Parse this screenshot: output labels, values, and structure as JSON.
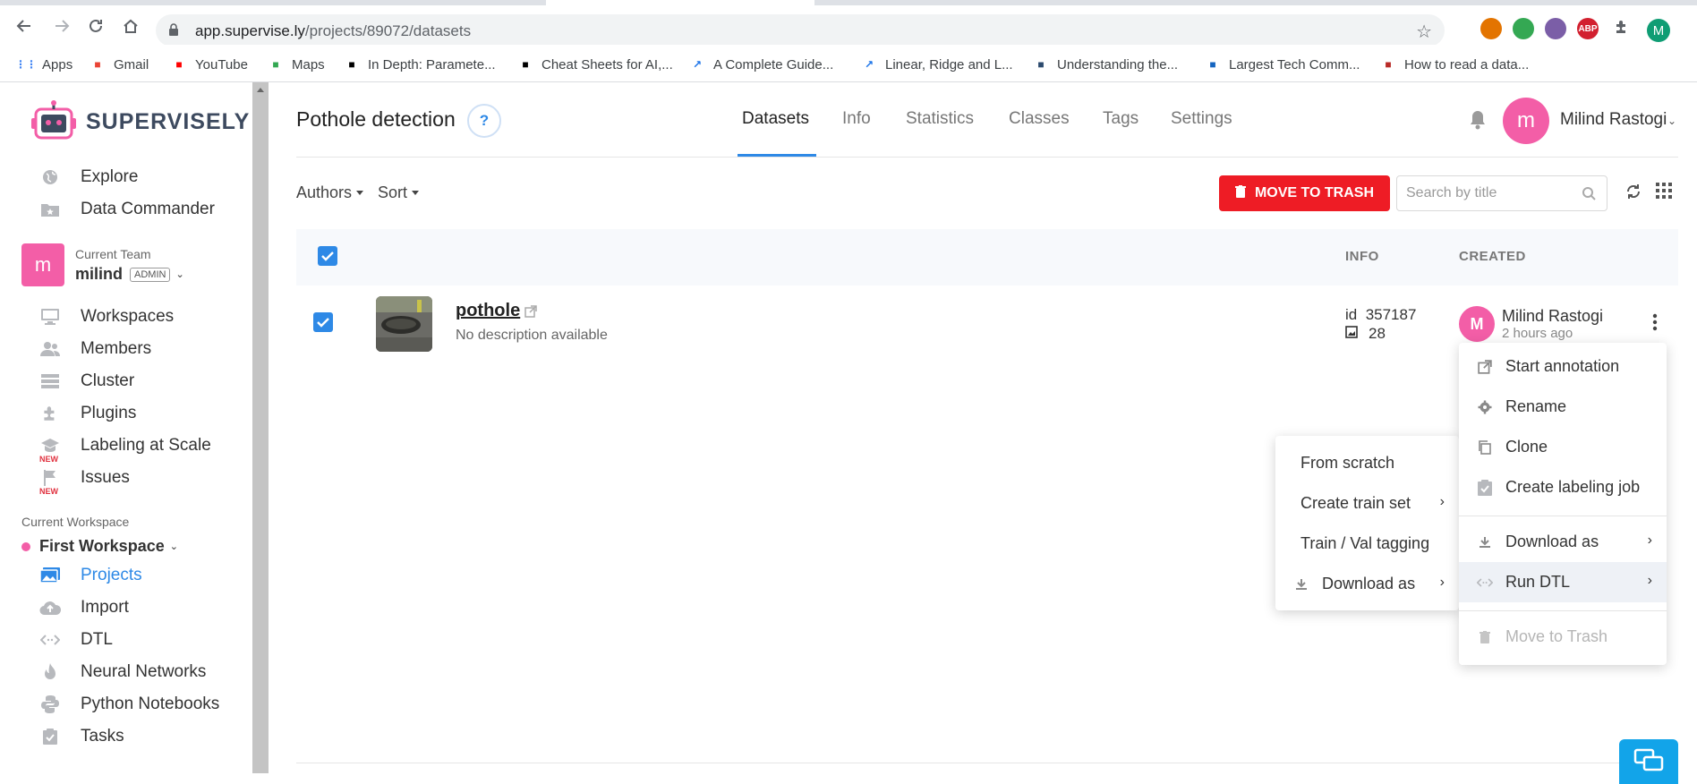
{
  "browser": {
    "url_host": "app.supervise.ly",
    "url_path": "/projects/89072/datasets",
    "profile_initial": "M",
    "extensions": [
      {
        "name": "extension-1",
        "color": "#e37400",
        "text": ""
      },
      {
        "name": "extension-2",
        "color": "#34a853",
        "text": ""
      },
      {
        "name": "extension-3",
        "color": "#7b5ea7",
        "text": ""
      },
      {
        "name": "adblock-plus",
        "color": "#d2202f",
        "text": "ABP"
      }
    ],
    "bookmarks": [
      {
        "label": "Apps",
        "icon": "apps-grid-icon",
        "color": "#4285f4"
      },
      {
        "label": "Gmail",
        "icon": "gmail-icon",
        "color": "#ea4335"
      },
      {
        "label": "YouTube",
        "icon": "youtube-icon",
        "color": "#ff0000"
      },
      {
        "label": "Maps",
        "icon": "maps-icon",
        "color": "#34a853"
      },
      {
        "label": "In Depth: Paramete...",
        "icon": "medium-icon",
        "color": "#000000"
      },
      {
        "label": "Cheat Sheets for AI,...",
        "icon": "cheatsheet-icon",
        "color": "#000000"
      },
      {
        "label": "A Complete Guide...",
        "icon": "chart-line-icon",
        "color": "#1a73e8"
      },
      {
        "label": "Linear, Ridge and L...",
        "icon": "chart-line-icon",
        "color": "#1a73e8"
      },
      {
        "label": "Understanding the...",
        "icon": "book-icon",
        "color": "#2c4a6e"
      },
      {
        "label": "Largest Tech Comm...",
        "icon": "tg-icon",
        "color": "#1565c0"
      },
      {
        "label": "How to read a data...",
        "icon": "quora-icon",
        "color": "#b92b27"
      }
    ]
  },
  "sidebar": {
    "logo_text": "SUPERVISELY",
    "top_items": [
      {
        "label": "Explore",
        "icon": "globe-icon"
      },
      {
        "label": "Data Commander",
        "icon": "folder-star-icon"
      }
    ],
    "team": {
      "caption": "Current Team",
      "initial": "m",
      "name": "milind",
      "role": "ADMIN"
    },
    "team_items": [
      {
        "label": "Workspaces",
        "icon": "monitor-icon",
        "new": false
      },
      {
        "label": "Members",
        "icon": "people-icon",
        "new": false
      },
      {
        "label": "Cluster",
        "icon": "server-icon",
        "new": false
      },
      {
        "label": "Plugins",
        "icon": "puzzle-icon",
        "new": false
      },
      {
        "label": "Labeling at Scale",
        "icon": "graduation-cap-icon",
        "new": true
      },
      {
        "label": "Issues",
        "icon": "flag-icon",
        "new": true
      }
    ],
    "new_badge": "NEW",
    "workspace": {
      "caption": "Current Workspace",
      "name": "First Workspace"
    },
    "workspace_items": [
      {
        "label": "Projects",
        "icon": "images-icon",
        "active": true
      },
      {
        "label": "Import",
        "icon": "cloud-upload-icon",
        "active": false
      },
      {
        "label": "DTL",
        "icon": "code-arrows-icon",
        "active": false
      },
      {
        "label": "Neural Networks",
        "icon": "flame-icon",
        "active": false
      },
      {
        "label": "Python Notebooks",
        "icon": "python-icon",
        "active": false
      },
      {
        "label": "Tasks",
        "icon": "clipboard-check-icon",
        "active": false
      }
    ]
  },
  "header": {
    "project_title": "Pothole detection",
    "help": "?",
    "tabs": [
      "Datasets",
      "Info",
      "Statistics",
      "Classes",
      "Tags",
      "Settings"
    ],
    "active_tab": "Datasets",
    "user_initial": "m",
    "user_name": "Milind Rastogi"
  },
  "toolbar": {
    "authors_label": "Authors",
    "sort_label": "Sort",
    "trash_label": "MOVE TO TRASH",
    "search_placeholder": "Search by title"
  },
  "table": {
    "columns": {
      "info": "INFO",
      "created": "CREATED"
    },
    "rows": [
      {
        "name": "pothole",
        "description": "No description available",
        "id_label": "id",
        "id": "357187",
        "image_count": "28",
        "creator_initial": "M",
        "creator": "Milind Rastogi",
        "created": "2 hours ago",
        "checked": true
      }
    ]
  },
  "context_menu": {
    "items": [
      {
        "label": "Start annotation",
        "icon": "external-link-icon"
      },
      {
        "label": "Rename",
        "icon": "gear-icon"
      },
      {
        "label": "Clone",
        "icon": "copy-icon"
      },
      {
        "label": "Create labeling job",
        "icon": "clipboard-check-icon"
      },
      {
        "label": "Download as",
        "icon": "download-icon",
        "submenu": true
      },
      {
        "label": "Run DTL",
        "icon": "code-arrows-icon",
        "submenu": true,
        "highlighted": true
      },
      {
        "label": "Move to Trash",
        "icon": "trash-icon",
        "disabled": true
      }
    ]
  },
  "dtl_submenu": {
    "items": [
      {
        "label": "From scratch",
        "submenu": false
      },
      {
        "label": "Create train set",
        "submenu": true
      },
      {
        "label": "Train / Val tagging",
        "submenu": false
      },
      {
        "label": "Download as",
        "submenu": true,
        "icon": "download-icon"
      }
    ]
  },
  "colors": {
    "accent": "#2e89e6",
    "danger": "#ee1c25",
    "brand_pink": "#f35ea7",
    "chat": "#12a4e9"
  }
}
